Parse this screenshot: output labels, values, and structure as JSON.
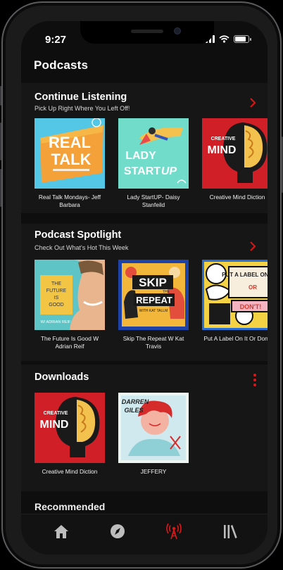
{
  "status": {
    "time": "9:27"
  },
  "header": {
    "title": "Podcasts"
  },
  "continue": {
    "title": "Continue Listening",
    "subtitle": "Pick Up Right Where You Left Off!",
    "items": [
      {
        "label": "Real Talk Mondays- Jeff Barbara",
        "art_word1": "REAL",
        "art_word2": "TALK"
      },
      {
        "label": "Lady StartUP- Daisy Stanfeild",
        "art_word1": "LADY",
        "art_word2": "START",
        "art_word3": "UP"
      },
      {
        "label": "Creative Mind Diction",
        "art_word1": "CREATIVE",
        "art_word2": "MIND"
      }
    ]
  },
  "spotlight": {
    "title": "Podcast Spotlight",
    "subtitle": "Check Out What's Hot This Week",
    "items": [
      {
        "label": "The Future Is Good W Adrian Reif",
        "art_word1": "THE",
        "art_word2": "FUTURE",
        "art_word3": "IS",
        "art_word4": "GOOD",
        "art_author": "W/ ADRIAN REIF"
      },
      {
        "label": "Skip The Repeat W Kat Travis",
        "art_word1": "SKIP",
        "art_word2": "THE",
        "art_word3": "REPEAT",
        "art_author": "WITH KAT TALLM"
      },
      {
        "label": "Put A Label On It Or Don't",
        "art_word1": "PUT A LABEL ON IT",
        "art_word2": "OR",
        "art_word3": "DON'T!"
      }
    ]
  },
  "downloads": {
    "title": "Downloads",
    "items": [
      {
        "label": "Creative Mind Diction",
        "art_word1": "CREATIVE",
        "art_word2": "MIND"
      },
      {
        "label": "JEFFERY",
        "art_word1": "DARREN",
        "art_word2": "GILES"
      }
    ]
  },
  "recommended": {
    "title": "Recommended"
  },
  "tabs": [
    {
      "name": "home-icon",
      "active": false
    },
    {
      "name": "compass-icon",
      "active": false
    },
    {
      "name": "broadcast-icon",
      "active": true
    },
    {
      "name": "library-icon",
      "active": false
    }
  ],
  "colors": {
    "accent": "#e01616",
    "section_bg": "#161616",
    "screen_bg": "#0e0e0e"
  }
}
